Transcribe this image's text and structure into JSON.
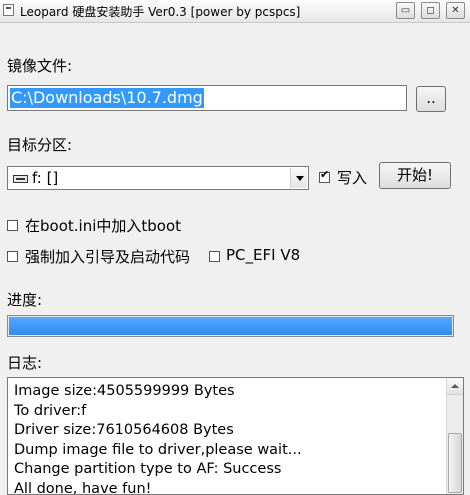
{
  "window": {
    "title": "Leopard 硬盘安装助手 Ver0.3 [power by pcspcs]",
    "controls": {
      "minimize": "▭",
      "restore": "◻",
      "close": "✕"
    }
  },
  "image_file": {
    "label": "镜像文件:",
    "value": "C:\\Downloads\\10.7.dmg",
    "browse_label": ".."
  },
  "target_partition": {
    "label": "目标分区:",
    "selected": "f: []",
    "write_label": "写入",
    "write_checked": true,
    "start_label": "开始!"
  },
  "options": {
    "tboot_label": "在boot.ini中加入tboot",
    "tboot_checked": false,
    "force_boot_label": "强制加入引导及启动代码",
    "force_boot_checked": false,
    "pc_efi_label": "PC_EFI V8",
    "pc_efi_checked": false
  },
  "progress": {
    "label": "进度:",
    "value_percent": 100
  },
  "log": {
    "label": "日志:",
    "lines": [
      "Image size:4505599999 Bytes",
      "To driver:f",
      "Driver size:7610564608 Bytes",
      "Dump image file to driver,please wait...",
      "Change partition type to AF: Success",
      "All done, have fun!"
    ]
  },
  "colors": {
    "selection": "#3399ff",
    "progress_fill": "#3399ff"
  }
}
